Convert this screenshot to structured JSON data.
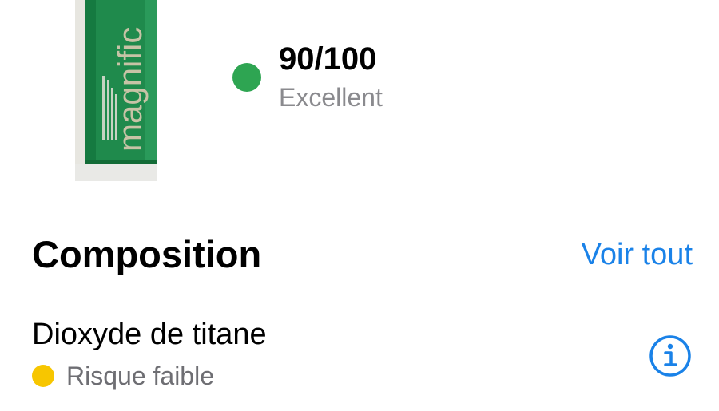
{
  "product": {
    "packaging_text": "magnific"
  },
  "score": {
    "value": "90/100",
    "label": "Excellent",
    "color": "#2ea552"
  },
  "composition": {
    "title": "Composition",
    "see_all_label": "Voir tout",
    "accent_color": "#1a82e8",
    "ingredients": [
      {
        "name": "Dioxyde de titane",
        "risk_label": "Risque faible",
        "risk_color": "#f7c600",
        "icon": "info-icon"
      }
    ]
  }
}
